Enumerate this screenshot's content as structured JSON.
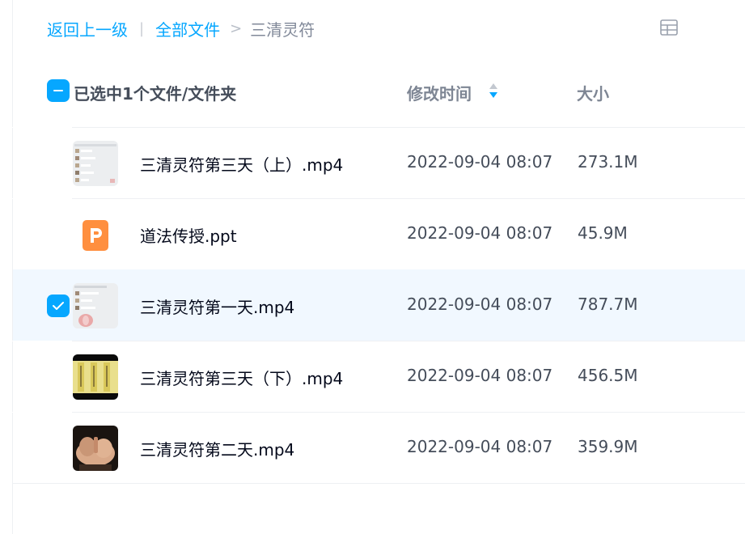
{
  "breadcrumb": {
    "back_label": "返回上一级",
    "separator": "|",
    "all_files_label": "全部文件",
    "arrow": ">",
    "current_folder": "三清灵符"
  },
  "toolbar": {
    "view_toggle_icon": "grid-view-icon"
  },
  "header": {
    "selected_label": "已选中1个文件/文件夹",
    "col_modified_time": "修改时间",
    "col_size": "大小"
  },
  "colors": {
    "accent": "#06a7ff",
    "selected_row_bg": "#f1f8ff"
  },
  "files": [
    {
      "name": "三清灵符第三天（上）.mp4",
      "time": "2022-09-04 08:07",
      "size": "273.1M",
      "type": "video",
      "selected": false
    },
    {
      "name": "道法传授.ppt",
      "time": "2022-09-04 08:07",
      "size": "45.9M",
      "type": "ppt",
      "selected": false
    },
    {
      "name": "三清灵符第一天.mp4",
      "time": "2022-09-04 08:07",
      "size": "787.7M",
      "type": "video",
      "selected": true
    },
    {
      "name": "三清灵符第三天（下）.mp4",
      "time": "2022-09-04 08:07",
      "size": "456.5M",
      "type": "video",
      "selected": false
    },
    {
      "name": "三清灵符第二天.mp4",
      "time": "2022-09-04 08:07",
      "size": "359.9M",
      "type": "video",
      "selected": false
    }
  ]
}
